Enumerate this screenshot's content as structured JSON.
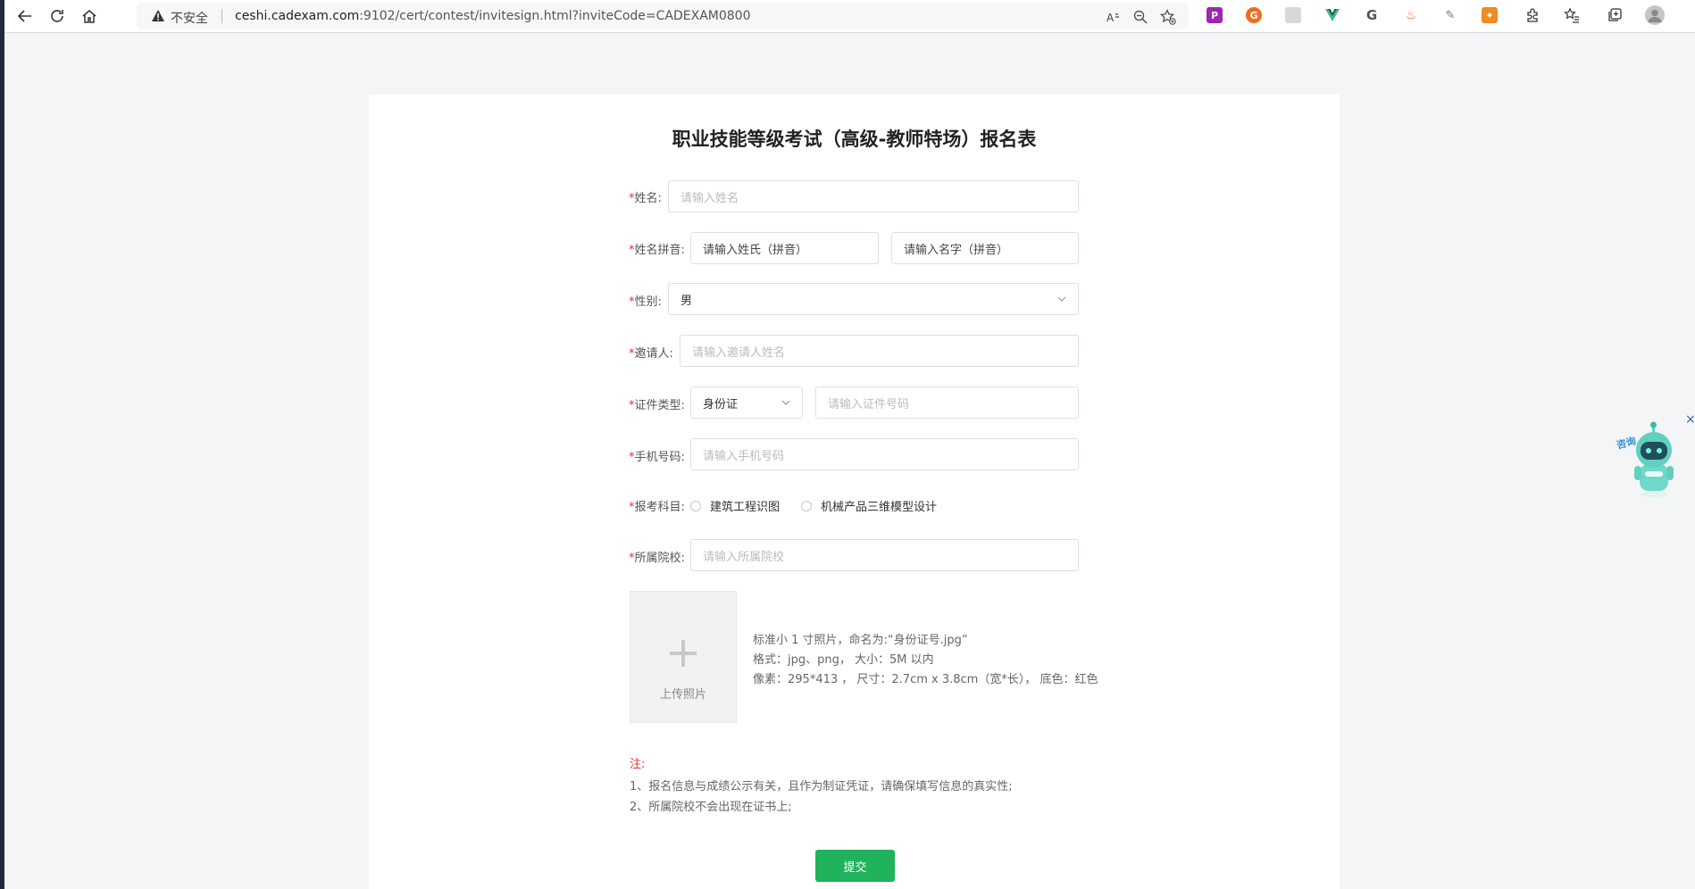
{
  "browser": {
    "insecure_label": "不安全",
    "url_host": "ceshi.cadexam.com",
    "url_rest": ":9102/cert/contest/invitesign.html?inviteCode=CADEXAM0800",
    "icons": [
      "back-icon",
      "refresh-icon",
      "home-icon",
      "warning-icon",
      "read-aloud-icon",
      "zoom-icon",
      "favorite-add-icon",
      "extensions-icon",
      "favorites-icon",
      "collections-icon",
      "profile-icon"
    ]
  },
  "form": {
    "title": "职业技能等级考试（高级-教师特场）报名表",
    "required_mark": "*",
    "name": {
      "label": "姓名:",
      "placeholder": "请输入姓名"
    },
    "pinyin": {
      "label": "姓名拼音:",
      "surname_placeholder": "请输入姓氏（拼音）",
      "given_placeholder": "请输入名字（拼音）"
    },
    "gender": {
      "label": "性别:",
      "value": "男"
    },
    "inviter": {
      "label": "邀请人:",
      "placeholder": "请输入邀请人姓名"
    },
    "id_type": {
      "label": "证件类型:",
      "value": "身份证",
      "number_placeholder": "请输入证件号码"
    },
    "phone": {
      "label": "手机号码:",
      "placeholder": "请输入手机号码"
    },
    "subject": {
      "label": "报考科目:",
      "options": [
        "建筑工程识图",
        "机械产品三维模型设计"
      ]
    },
    "school": {
      "label": "所属院校:",
      "placeholder": "请输入所属院校"
    },
    "upload": {
      "button_label": "上传照片",
      "hints": [
        "标准小 1 寸照片，命名为:“身份证号.jpg”",
        "格式：jpg、png， 大小：5M 以内",
        "像素：295*413 ， 尺寸：2.7cm x 3.8cm（宽*长）， 底色：红色"
      ]
    },
    "notes": {
      "title": "注:",
      "items": [
        "1、报名信息与成绩公示有关，且作为制证凭证，请确保填写信息的真实性;",
        "2、所属院校不会出现在证书上;"
      ]
    },
    "submit_label": "提交"
  },
  "widget": {
    "consult_label": "咨询",
    "close_glyph": "×"
  },
  "colors": {
    "accent_green": "#20b35c",
    "required_red": "#e0302f",
    "background": "#f4f5f7"
  }
}
